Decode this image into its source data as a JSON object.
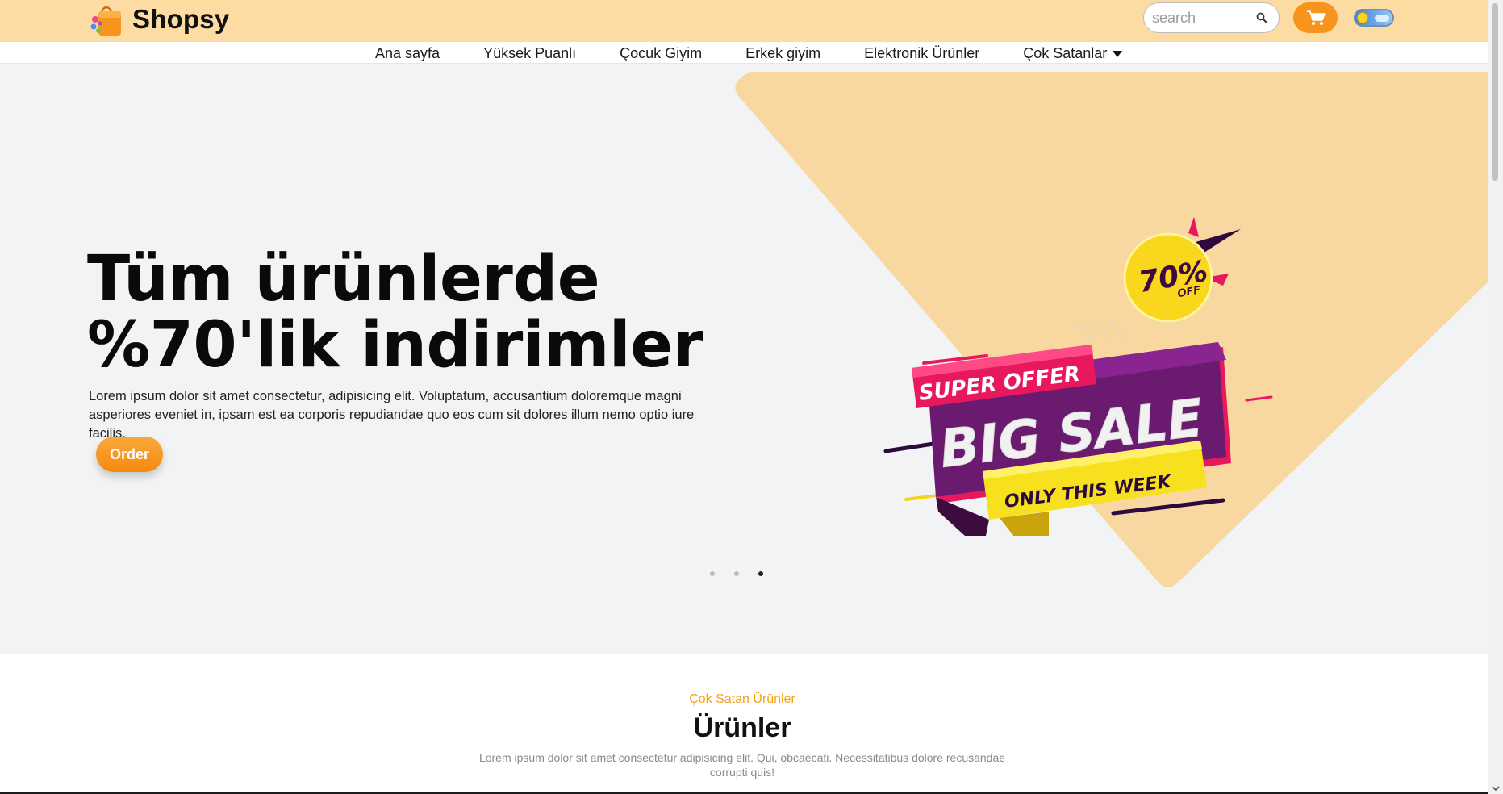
{
  "header": {
    "brand": "Shopsy",
    "logo_icon": "shopping-bag-icon",
    "search": {
      "placeholder": "search",
      "value": "",
      "icon": "search-icon"
    },
    "cart_icon": "cart-icon",
    "theme_toggle_icon": "sun-cloud-toggle-icon",
    "colors": {
      "topbar_bg": "#fddca4",
      "accent": "#f7941e"
    }
  },
  "nav": {
    "items": [
      {
        "label": "Ana sayfa"
      },
      {
        "label": "Yüksek Puanlı"
      },
      {
        "label": "Çocuk Giyim"
      },
      {
        "label": "Erkek giyim"
      },
      {
        "label": "Elektronik Ürünler"
      },
      {
        "label": "Çok Satanlar",
        "icon": "caret-down-icon"
      }
    ]
  },
  "hero": {
    "title_line1": "Tüm ürünlerde",
    "title_line2": "%70'lik indirimler",
    "description": "Lorem ipsum dolor sit amet consectetur, adipisicing elit. Voluptatum, accusantium doloremque magni asperiores eveniet in, ipsam est ea corporis repudiandae quo eos cum sit dolores illum nemo optio iure facilis.",
    "order_label": "Order",
    "banner": {
      "super_offer": "SUPER OFFER",
      "big_sale": "BIG SALE",
      "only_this_week": "ONLY THIS WEEK",
      "percent": "70%",
      "off": "OFF"
    },
    "slides_total": 3,
    "active_slide": 3,
    "colors": {
      "hero_bg": "#f2f3f5",
      "diamond": "#f8d7a1"
    }
  },
  "products": {
    "subtitle": "Çok Satan Ürünler",
    "title": "Ürünler",
    "description": "Lorem ipsum dolor sit amet consectetur adipisicing elit. Qui, obcaecati. Necessitatibus dolore recusandae corrupti quis!"
  }
}
